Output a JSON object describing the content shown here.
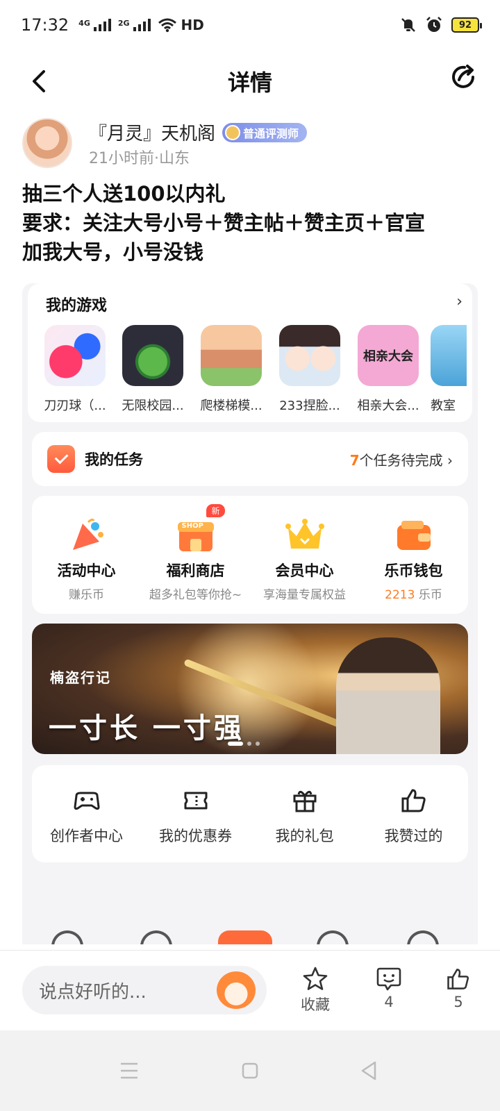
{
  "status_bar": {
    "time": "17:32",
    "net1": "4G",
    "net2": "2G",
    "hd": "HD",
    "battery": "92"
  },
  "header": {
    "title": "详情",
    "back_icon": "chevron-left-icon",
    "share_icon": "share-icon"
  },
  "author": {
    "name": "『月灵』天机阁",
    "badge": "普通评测师",
    "meta": "21小时前·山东"
  },
  "post": {
    "lines": [
      "抽三个人送100以内礼",
      "要求：关注大号小号＋赞主帖＋赞主页＋官宣",
      "加我大号，小号没钱"
    ]
  },
  "embed": {
    "games_title": "我的游戏",
    "games": [
      {
        "name": "刀刃球（...",
        "color": "#e23d6a"
      },
      {
        "name": "无限校园...",
        "color": "#3b3b48"
      },
      {
        "name": "爬楼梯模...",
        "color": "#e9b07a"
      },
      {
        "name": "233捏脸...",
        "color": "#f2d4c2"
      },
      {
        "name": "相亲大会...",
        "color": "#f6a8d6",
        "icon_text": "相亲大会"
      },
      {
        "name": "教室",
        "color": "#8fd0f2"
      }
    ],
    "tasks": {
      "label": "我的任务",
      "count": "7",
      "suffix": "个任务待完成"
    },
    "services": [
      {
        "name": "活动中心",
        "sub": "赚乐币",
        "icon": "party-popper-icon"
      },
      {
        "name": "福利商店",
        "sub": "超多礼包等你抢~",
        "icon": "shop-icon",
        "tag": "新",
        "icon_text": "SHOP"
      },
      {
        "name": "会员中心",
        "sub": "享海量专属权益",
        "icon": "crown-icon"
      },
      {
        "name": "乐币钱包",
        "sub_value": "2213",
        "sub_unit": "乐币",
        "icon": "wallet-icon"
      }
    ],
    "banner": {
      "logo": "楠盗行记",
      "slogan": "一寸长 一寸强"
    },
    "tools": [
      {
        "name": "创作者中心",
        "icon": "gamepad-icon"
      },
      {
        "name": "我的优惠券",
        "icon": "ticket-icon"
      },
      {
        "name": "我的礼包",
        "icon": "gift-icon"
      },
      {
        "name": "我赞过的",
        "icon": "thumbs-up-icon"
      }
    ]
  },
  "action_bar": {
    "placeholder": "说点好听的...",
    "favorite_label": "收藏",
    "comment_count": "4",
    "like_count": "5"
  },
  "colors": {
    "accent": "#ff7a1a",
    "badge": "#7d8ee8"
  }
}
